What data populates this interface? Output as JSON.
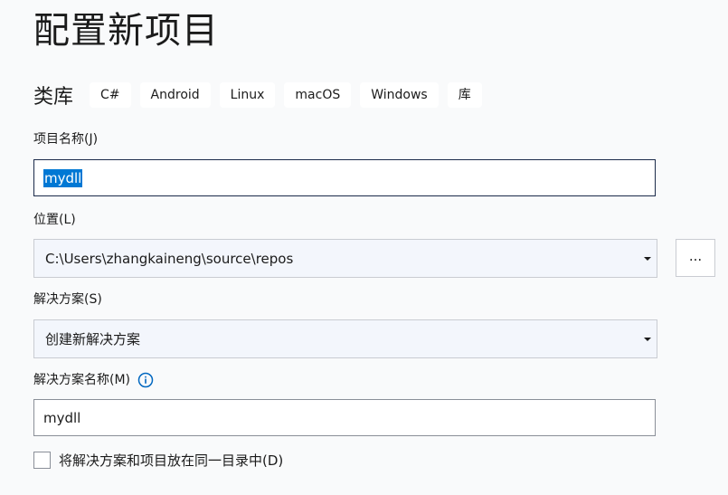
{
  "page": {
    "title": "配置新项目"
  },
  "template": {
    "name": "类库",
    "tags": [
      "C#",
      "Android",
      "Linux",
      "macOS",
      "Windows",
      "库"
    ]
  },
  "project_name": {
    "label": "项目名称(J)",
    "value": "mydll"
  },
  "location": {
    "label": "位置(L)",
    "value": "C:\\Users\\zhangkaineng\\source\\repos",
    "browse_label": "..."
  },
  "solution": {
    "label": "解决方案(S)",
    "value": "创建新解决方案"
  },
  "solution_name": {
    "label": "解决方案名称(M)",
    "value": "mydll",
    "info_icon": "info-icon"
  },
  "same_directory": {
    "label": "将解决方案和项目放在同一目录中(D)",
    "checked": false
  },
  "colors": {
    "accent": "#0078d4",
    "background": "#f9fafb"
  }
}
